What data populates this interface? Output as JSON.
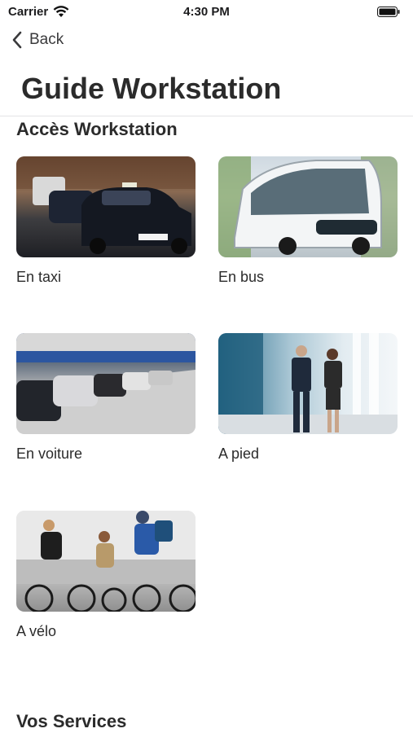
{
  "status_bar": {
    "carrier": "Carrier",
    "time": "4:30 PM"
  },
  "nav": {
    "back_label": "Back"
  },
  "page": {
    "title": "Guide Workstation"
  },
  "sections": [
    {
      "title": "Accès Workstation",
      "items": [
        {
          "label": "En taxi",
          "image": "taxi-photo"
        },
        {
          "label": "En bus",
          "image": "bus-photo"
        },
        {
          "label": "En voiture",
          "image": "parking-photo"
        },
        {
          "label": "A pied",
          "image": "walking-photo"
        },
        {
          "label": "A vélo",
          "image": "cycling-photo"
        }
      ]
    },
    {
      "title": "Vos Services"
    }
  ],
  "colors": {
    "text": "#2b2b2b",
    "divider": "#e4e4e6",
    "background": "#ffffff"
  }
}
